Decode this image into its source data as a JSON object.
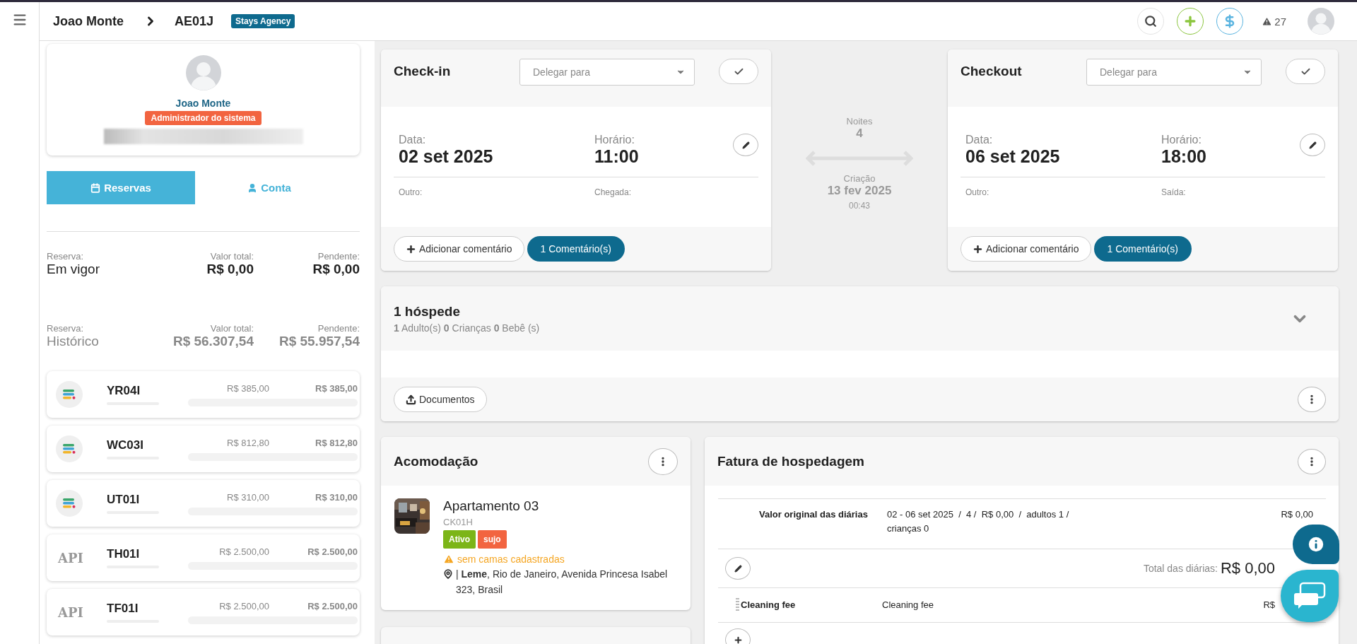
{
  "topbar": {
    "breadcrumb": [
      "Joao Monte",
      "AE01J"
    ],
    "badge": "Stays Agency",
    "alerts": "27"
  },
  "profile": {
    "name": "Joao Monte",
    "role": "Administrador do sistema"
  },
  "tabs": [
    {
      "label": "Reservas",
      "selected": true
    },
    {
      "label": "Conta",
      "selected": false
    }
  ],
  "summaries": [
    {
      "label": "Reserva:",
      "status": "Em vigor",
      "total_label": "Valor total:",
      "total": "R$ 0,00",
      "pending_label": "Pendente:",
      "pending": "R$ 0,00",
      "muted": false
    },
    {
      "label": "Reserva:",
      "status": "Histórico",
      "total_label": "Valor total:",
      "total": "R$ 56.307,54",
      "pending_label": "Pendente:",
      "pending": "R$ 55.957,54",
      "muted": true
    }
  ],
  "reservations": [
    {
      "code": "YR04I",
      "kind": "stays",
      "total": "R$ 385,00",
      "pending": "R$ 385,00"
    },
    {
      "code": "WC03I",
      "kind": "stays",
      "total": "R$ 812,80",
      "pending": "R$ 812,80"
    },
    {
      "code": "UT01I",
      "kind": "stays",
      "total": "R$ 310,00",
      "pending": "R$ 310,00"
    },
    {
      "code": "TH01I",
      "kind": "api",
      "logo": "API",
      "total": "R$ 2.500,00",
      "pending": "R$ 2.500,00"
    },
    {
      "code": "TF01I",
      "kind": "api",
      "logo": "API",
      "total": "R$ 2.500,00",
      "pending": "R$ 2.500,00"
    }
  ],
  "checkin": {
    "title": "Check-in",
    "delegate_placeholder": "Delegar para",
    "date_label": "Data:",
    "date": "02 set 2025",
    "time_label": "Horário:",
    "time": "11:00",
    "other_label": "Outro:",
    "extra_label": "Chegada:",
    "add_comment": "Adicionar comentário",
    "comments": "1 Comentário(s)"
  },
  "stay": {
    "nights_label": "Noites",
    "nights": "4",
    "created_label": "Criação",
    "created_date": "13 fev 2025",
    "created_time": "00:43"
  },
  "checkout": {
    "title": "Checkout",
    "delegate_placeholder": "Delegar para",
    "date_label": "Data:",
    "date": "06 set 2025",
    "time_label": "Horário:",
    "time": "18:00",
    "other_label": "Outro:",
    "extra_label": "Saída:",
    "add_comment": "Adicionar comentário",
    "comments": "1 Comentário(s)"
  },
  "guests": {
    "title": "1 hóspede",
    "summary": "**1** Adulto(s) **0** Crianças **0** Bebê (s)",
    "documents": "Documentos"
  },
  "accommodation": {
    "title": "Acomodação",
    "name": "Apartamento 03",
    "code": "CK01H",
    "tags": [
      {
        "label": "Ativo",
        "color": "#7cb518"
      },
      {
        "label": "sujo",
        "color": "#f26440"
      }
    ],
    "warning": "sem camas cadastradas",
    "address": "| **Leme**, Rio de Janeiro, Avenida Princesa Isabel 323, Brasil"
  },
  "invoice": {
    "title": "Fatura de hospedagem",
    "rows": [
      {
        "label": "Valor original das diárias",
        "details": "02 - 06 set 2025  /  4 /  R$ 0,00  /  adultos 1 /  crianças 0",
        "amount": "R$ 0,00"
      }
    ],
    "total_label": "Total das diárias:",
    "total": "R$ 0,00",
    "fees": [
      {
        "label": "Cleaning fee",
        "details": "Cleaning fee",
        "amount": "R$"
      }
    ]
  }
}
